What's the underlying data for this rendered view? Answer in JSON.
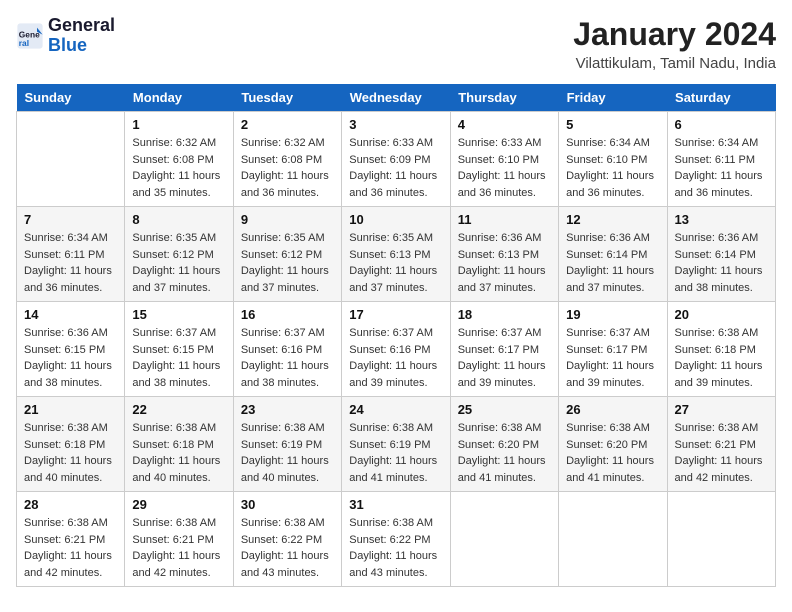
{
  "header": {
    "logo_line1": "General",
    "logo_line2": "Blue",
    "title": "January 2024",
    "subtitle": "Vilattikulam, Tamil Nadu, India"
  },
  "weekdays": [
    "Sunday",
    "Monday",
    "Tuesday",
    "Wednesday",
    "Thursday",
    "Friday",
    "Saturday"
  ],
  "weeks": [
    [
      {
        "day": "",
        "detail": ""
      },
      {
        "day": "1",
        "detail": "Sunrise: 6:32 AM\nSunset: 6:08 PM\nDaylight: 11 hours\nand 35 minutes."
      },
      {
        "day": "2",
        "detail": "Sunrise: 6:32 AM\nSunset: 6:08 PM\nDaylight: 11 hours\nand 36 minutes."
      },
      {
        "day": "3",
        "detail": "Sunrise: 6:33 AM\nSunset: 6:09 PM\nDaylight: 11 hours\nand 36 minutes."
      },
      {
        "day": "4",
        "detail": "Sunrise: 6:33 AM\nSunset: 6:10 PM\nDaylight: 11 hours\nand 36 minutes."
      },
      {
        "day": "5",
        "detail": "Sunrise: 6:34 AM\nSunset: 6:10 PM\nDaylight: 11 hours\nand 36 minutes."
      },
      {
        "day": "6",
        "detail": "Sunrise: 6:34 AM\nSunset: 6:11 PM\nDaylight: 11 hours\nand 36 minutes."
      }
    ],
    [
      {
        "day": "7",
        "detail": "Sunrise: 6:34 AM\nSunset: 6:11 PM\nDaylight: 11 hours\nand 36 minutes."
      },
      {
        "day": "8",
        "detail": "Sunrise: 6:35 AM\nSunset: 6:12 PM\nDaylight: 11 hours\nand 37 minutes."
      },
      {
        "day": "9",
        "detail": "Sunrise: 6:35 AM\nSunset: 6:12 PM\nDaylight: 11 hours\nand 37 minutes."
      },
      {
        "day": "10",
        "detail": "Sunrise: 6:35 AM\nSunset: 6:13 PM\nDaylight: 11 hours\nand 37 minutes."
      },
      {
        "day": "11",
        "detail": "Sunrise: 6:36 AM\nSunset: 6:13 PM\nDaylight: 11 hours\nand 37 minutes."
      },
      {
        "day": "12",
        "detail": "Sunrise: 6:36 AM\nSunset: 6:14 PM\nDaylight: 11 hours\nand 37 minutes."
      },
      {
        "day": "13",
        "detail": "Sunrise: 6:36 AM\nSunset: 6:14 PM\nDaylight: 11 hours\nand 38 minutes."
      }
    ],
    [
      {
        "day": "14",
        "detail": "Sunrise: 6:36 AM\nSunset: 6:15 PM\nDaylight: 11 hours\nand 38 minutes."
      },
      {
        "day": "15",
        "detail": "Sunrise: 6:37 AM\nSunset: 6:15 PM\nDaylight: 11 hours\nand 38 minutes."
      },
      {
        "day": "16",
        "detail": "Sunrise: 6:37 AM\nSunset: 6:16 PM\nDaylight: 11 hours\nand 38 minutes."
      },
      {
        "day": "17",
        "detail": "Sunrise: 6:37 AM\nSunset: 6:16 PM\nDaylight: 11 hours\nand 39 minutes."
      },
      {
        "day": "18",
        "detail": "Sunrise: 6:37 AM\nSunset: 6:17 PM\nDaylight: 11 hours\nand 39 minutes."
      },
      {
        "day": "19",
        "detail": "Sunrise: 6:37 AM\nSunset: 6:17 PM\nDaylight: 11 hours\nand 39 minutes."
      },
      {
        "day": "20",
        "detail": "Sunrise: 6:38 AM\nSunset: 6:18 PM\nDaylight: 11 hours\nand 39 minutes."
      }
    ],
    [
      {
        "day": "21",
        "detail": "Sunrise: 6:38 AM\nSunset: 6:18 PM\nDaylight: 11 hours\nand 40 minutes."
      },
      {
        "day": "22",
        "detail": "Sunrise: 6:38 AM\nSunset: 6:18 PM\nDaylight: 11 hours\nand 40 minutes."
      },
      {
        "day": "23",
        "detail": "Sunrise: 6:38 AM\nSunset: 6:19 PM\nDaylight: 11 hours\nand 40 minutes."
      },
      {
        "day": "24",
        "detail": "Sunrise: 6:38 AM\nSunset: 6:19 PM\nDaylight: 11 hours\nand 41 minutes."
      },
      {
        "day": "25",
        "detail": "Sunrise: 6:38 AM\nSunset: 6:20 PM\nDaylight: 11 hours\nand 41 minutes."
      },
      {
        "day": "26",
        "detail": "Sunrise: 6:38 AM\nSunset: 6:20 PM\nDaylight: 11 hours\nand 41 minutes."
      },
      {
        "day": "27",
        "detail": "Sunrise: 6:38 AM\nSunset: 6:21 PM\nDaylight: 11 hours\nand 42 minutes."
      }
    ],
    [
      {
        "day": "28",
        "detail": "Sunrise: 6:38 AM\nSunset: 6:21 PM\nDaylight: 11 hours\nand 42 minutes."
      },
      {
        "day": "29",
        "detail": "Sunrise: 6:38 AM\nSunset: 6:21 PM\nDaylight: 11 hours\nand 42 minutes."
      },
      {
        "day": "30",
        "detail": "Sunrise: 6:38 AM\nSunset: 6:22 PM\nDaylight: 11 hours\nand 43 minutes."
      },
      {
        "day": "31",
        "detail": "Sunrise: 6:38 AM\nSunset: 6:22 PM\nDaylight: 11 hours\nand 43 minutes."
      },
      {
        "day": "",
        "detail": ""
      },
      {
        "day": "",
        "detail": ""
      },
      {
        "day": "",
        "detail": ""
      }
    ]
  ]
}
